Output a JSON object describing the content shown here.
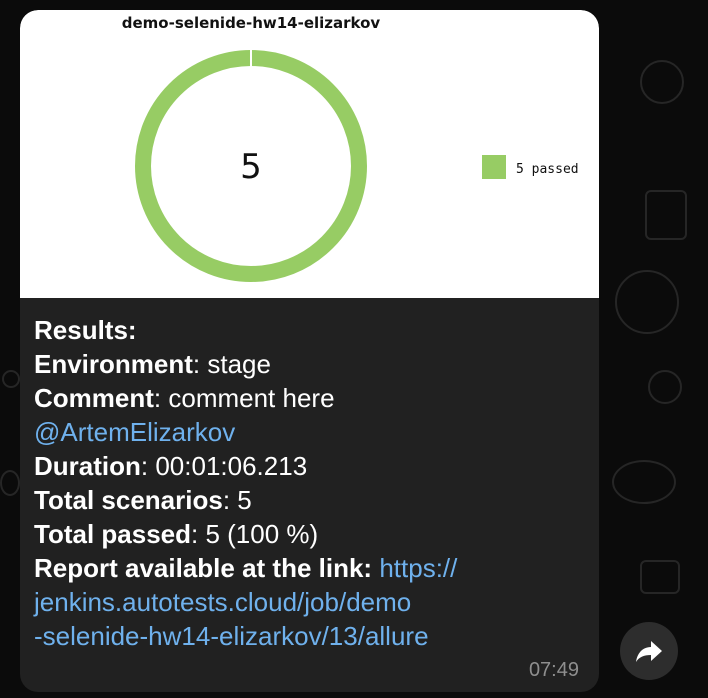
{
  "chart": {
    "title": "demo-selenide-hw14-elizarkov",
    "center_value": "5",
    "legend_label": "5 passed",
    "color_passed": "#97cc64"
  },
  "chart_data": {
    "type": "pie",
    "title": "demo-selenide-hw14-elizarkov",
    "categories": [
      "passed"
    ],
    "values": [
      5
    ],
    "legend": [
      "5 passed"
    ],
    "legend_position": "right"
  },
  "message": {
    "results_label": "Results:",
    "environment_label": "Environment",
    "environment_value": ": stage",
    "comment_label": "Comment",
    "comment_value": ": comment here",
    "mention": "@ArtemElizarkov",
    "duration_label": "Duration",
    "duration_value": ": 00:01:06.213",
    "total_scenarios_label": "Total scenarios",
    "total_scenarios_value": ": 5",
    "total_passed_label": "Total passed",
    "total_passed_value": ": 5 (100 %)",
    "report_label": "Report available at the link:",
    "report_link_line1": "https://",
    "report_link_line2": "jenkins.autotests.cloud/job/demo",
    "report_link_line3": "-selenide-hw14-elizarkov/13/allure",
    "time": "07:49"
  },
  "icons": {
    "forward": "forward-arrow-icon"
  }
}
